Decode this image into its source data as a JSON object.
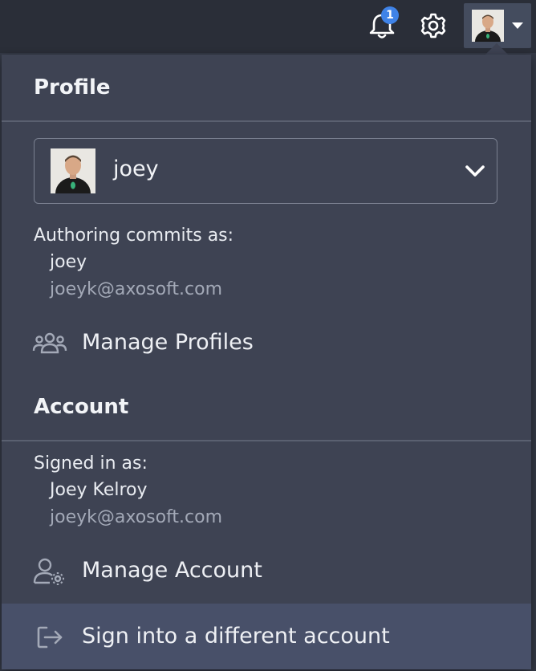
{
  "topbar": {
    "notifications_count": "1"
  },
  "profile": {
    "section_title": "Profile",
    "selected_profile": "joey",
    "authoring_label": "Authoring commits as:",
    "author_name": "joey",
    "author_email": "joeyk@axosoft.com",
    "manage_profiles_label": "Manage Profiles"
  },
  "account": {
    "section_title": "Account",
    "signed_in_label": "Signed in as:",
    "user_name": "Joey Kelroy",
    "user_email": "joeyk@axosoft.com",
    "manage_account_label": "Manage Account",
    "sign_in_different_label": "Sign into a different account"
  },
  "colors": {
    "menu_bg": "#3e4353",
    "hover_bg": "#485069",
    "badge": "#3f83e8"
  }
}
